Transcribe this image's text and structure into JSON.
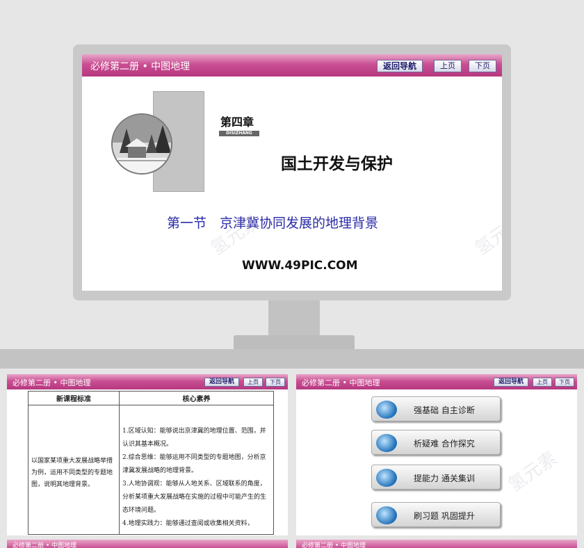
{
  "main_slide": {
    "header_title": "必修第二册 • 中图地理",
    "nav_buttons": [
      "返回导航",
      "上页",
      "下页"
    ],
    "chapter": "第四章",
    "chapter_pinyin": "DISIZHANG",
    "chapter_title": "国土开发与保护",
    "section_title": "第一节　京津冀协同发展的地理背景",
    "website": "WWW.49PIC.COM"
  },
  "slide_left": {
    "header_title": "必修第二册 • 中图地理",
    "nav_buttons": [
      "返回导航",
      "上页",
      "下页"
    ],
    "table": {
      "headers": [
        "新课程标准",
        "核心素养"
      ],
      "standard": "以国家某项重大发展战略举措为例，运用不同类型的专题地图，说明其地理背景。",
      "literacy": [
        "1.区域认知：能够说出京津冀的地理位置、范围，并认识其基本概况。",
        "2.综合思维：能够运用不同类型的专题地图，分析京津冀发展战略的地理背景。",
        "3.人地协调观：能够从人地关系、区域联系的角度，分析某项重大发展战略在实施的过程中可能产生的生态环境问题。",
        "4.地理实践力：能够通过查阅或收集相关资料，"
      ]
    }
  },
  "slide_right": {
    "header_title": "必修第二册 • 中图地理",
    "nav_buttons": [
      "返回导航",
      "上页",
      "下页"
    ],
    "menu_items": [
      "强基础 自主诊断",
      "析疑难 合作探究",
      "提能力 通关集训",
      "刷习题 巩固提升"
    ]
  },
  "bottom_strips": [
    "必修第二册 • 中图地理",
    "必修第二册 • 中图地理"
  ],
  "colors": {
    "header_pink": "#c94f93",
    "section_blue": "#2a2aa8"
  }
}
